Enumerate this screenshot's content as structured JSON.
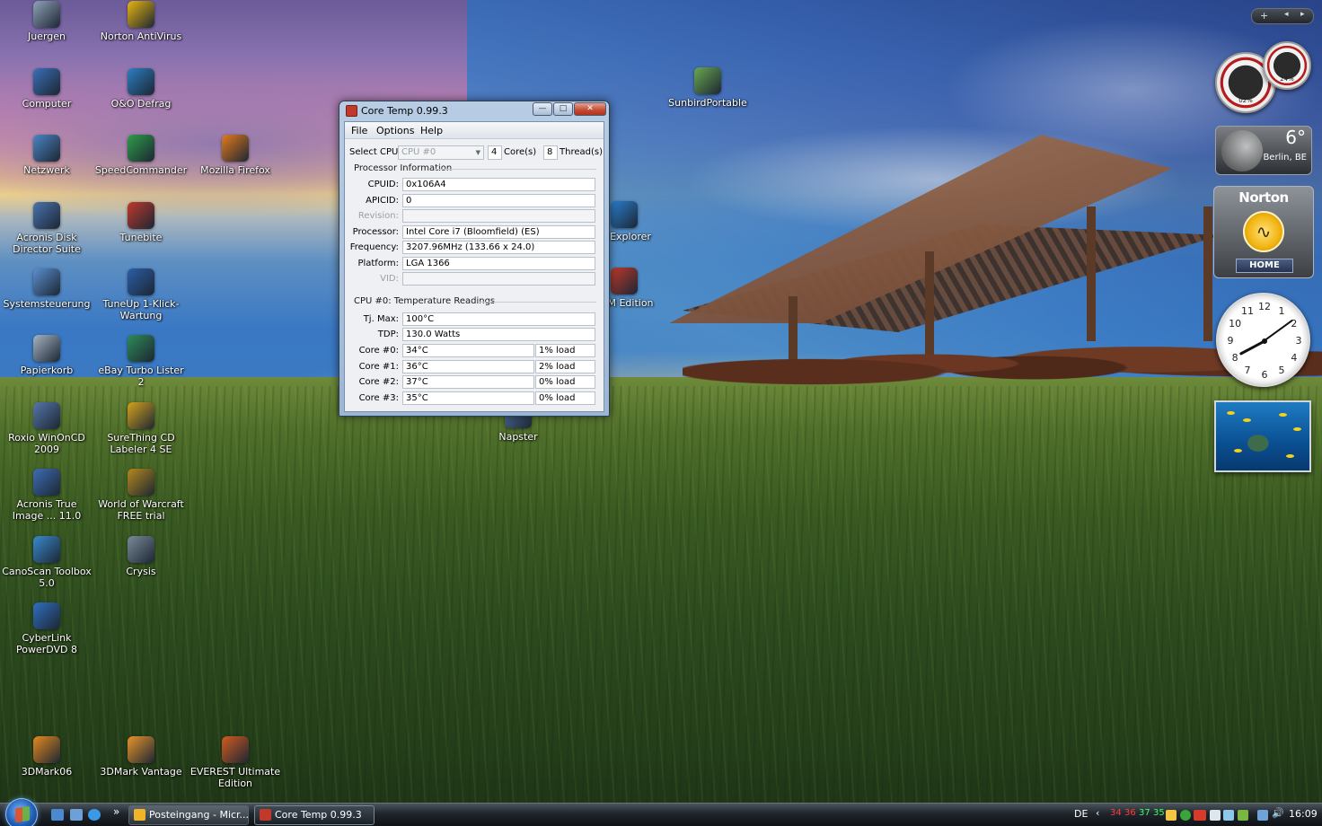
{
  "desktop_icons": [
    {
      "label": "Juergen",
      "icon": "user-folder-icon",
      "color": "#8fa3b8"
    },
    {
      "label": "Norton AntiVirus",
      "icon": "norton-antivirus-icon",
      "color": "#e7b50f"
    },
    {
      "label": "Computer",
      "icon": "computer-icon",
      "color": "#3a6fb8"
    },
    {
      "label": "O&O Defrag",
      "icon": "defrag-icon",
      "color": "#2b7fc2"
    },
    {
      "label": "Netzwerk",
      "icon": "network-icon",
      "color": "#4a86c7"
    },
    {
      "label": "SpeedCommander",
      "icon": "speedcommander-icon",
      "color": "#2e9d4a"
    },
    {
      "label": "Mozilla Firefox",
      "icon": "firefox-icon",
      "color": "#e37a1b"
    },
    {
      "label": "Acronis Disk Director Suite",
      "icon": "acronis-disk-icon",
      "color": "#4a74b0"
    },
    {
      "label": "Tunebite",
      "icon": "tunebite-icon",
      "color": "#c0392b"
    },
    {
      "label": "Systemsteuerung",
      "icon": "control-panel-icon",
      "color": "#5b8fd0"
    },
    {
      "label": "TuneUp 1-Klick-Wartung",
      "icon": "tuneup-icon",
      "color": "#2a5fa8"
    },
    {
      "label": "Papierkorb",
      "icon": "recycle-bin-icon",
      "color": "#a6b4c2"
    },
    {
      "label": "eBay Turbo Lister 2",
      "icon": "ebay-icon",
      "color": "#2e8b57"
    },
    {
      "label": "Roxio WinOnCD 2009",
      "icon": "roxio-icon",
      "color": "#5577aa"
    },
    {
      "label": "SureThing CD Labeler 4 SE",
      "icon": "surething-icon",
      "color": "#d5a21c"
    },
    {
      "label": "Acronis True Image ... 11.0",
      "icon": "acronis-true-image-icon",
      "color": "#3d6db5"
    },
    {
      "label": "World of Warcraft FREE trial",
      "icon": "warcraft-icon",
      "color": "#b5891d"
    },
    {
      "label": "CanoScan Toolbox 5.0",
      "icon": "canoscan-icon",
      "color": "#3a8ad0"
    },
    {
      "label": "Crysis",
      "icon": "crysis-icon",
      "color": "#7a8a99"
    },
    {
      "label": "CyberLink PowerDVD 8",
      "icon": "powerdvd-icon",
      "color": "#2f6fc0"
    },
    {
      "label": "3DMark06",
      "icon": "3dmark06-icon",
      "color": "#e48a1f"
    },
    {
      "label": "3DMark Vantage",
      "icon": "3dmark-vantage-icon",
      "color": "#e8942a"
    },
    {
      "label": "EVEREST Ultimate Edition",
      "icon": "everest-icon",
      "color": "#d35b1f"
    },
    {
      "label": "SunbirdPortable",
      "icon": "sunbird-icon",
      "color": "#6aa84f"
    },
    {
      "label": "Explorer",
      "icon": "explorer-icon",
      "color": "#2a7fd0"
    },
    {
      "label": "M Edition",
      "icon": "m-edition-icon",
      "color": "#c0392b"
    },
    {
      "label": "Napster",
      "icon": "napster-icon",
      "color": "#5a7fb0"
    }
  ],
  "window": {
    "title": "Core Temp 0.99.3",
    "menu": [
      "File",
      "Options",
      "Help"
    ],
    "select_cpu_label": "Select CPU:",
    "select_cpu_value": "CPU #0",
    "cores_value": "4",
    "cores_label": "Core(s)",
    "threads_value": "8",
    "threads_label": "Thread(s)",
    "processor_info_heading": "Processor Information",
    "info_rows": [
      {
        "label": "CPUID:",
        "value": "0x106A4",
        "disabled": false
      },
      {
        "label": "APICID:",
        "value": "0",
        "disabled": false
      },
      {
        "label": "Revision:",
        "value": "",
        "disabled": true
      },
      {
        "label": "Processor:",
        "value": "Intel Core i7 (Bloomfield) (ES)",
        "disabled": false
      },
      {
        "label": "Frequency:",
        "value": "3207.96MHz (133.66 x 24.0)",
        "disabled": false
      },
      {
        "label": "Platform:",
        "value": "LGA 1366",
        "disabled": false
      },
      {
        "label": "VID:",
        "value": "",
        "disabled": true
      }
    ],
    "temp_heading": "CPU #0: Temperature Readings",
    "tj_max_label": "Tj. Max:",
    "tj_max_value": "100°C",
    "tdp_label": "TDP:",
    "tdp_value": "130.0 Watts",
    "cores": [
      {
        "label": "Core #0:",
        "temp": "34°C",
        "load": "1% load"
      },
      {
        "label": "Core #1:",
        "temp": "36°C",
        "load": "2% load"
      },
      {
        "label": "Core #2:",
        "temp": "37°C",
        "load": "0% load"
      },
      {
        "label": "Core #3:",
        "temp": "35°C",
        "load": "0% load"
      }
    ],
    "buttons": {
      "minimize": "—",
      "maximize": "□",
      "close": "✕"
    }
  },
  "gadgets": {
    "toolbar": {
      "add": "+",
      "prev": "◂",
      "next": "▸"
    },
    "cpu_meter": {
      "cpu": "02%",
      "ram": "24%"
    },
    "weather": {
      "temp": "6°",
      "city": "Berlin, BE"
    },
    "norton": {
      "brand": "Norton",
      "home": "HOME"
    },
    "clock": {
      "numbers": [
        "12",
        "1",
        "2",
        "3",
        "4",
        "5",
        "6",
        "7",
        "8",
        "9",
        "10",
        "11"
      ]
    }
  },
  "taskbar": {
    "tasks": [
      {
        "label": "Posteingang - Micr...",
        "icon": "outlook-icon",
        "color": "#f0b429"
      },
      {
        "label": "Core Temp 0.99.3",
        "icon": "coretemp-icon",
        "color": "#c0392b"
      }
    ],
    "quicklaunch_more": "»",
    "tray": {
      "language": "DE",
      "temps": [
        {
          "value": "34",
          "color": "#ff3b3b"
        },
        {
          "value": "36",
          "color": "#ff3b3b"
        },
        {
          "value": "37",
          "color": "#3bff5e"
        },
        {
          "value": "35",
          "color": "#3bff5e"
        }
      ],
      "time": "16:09"
    }
  }
}
